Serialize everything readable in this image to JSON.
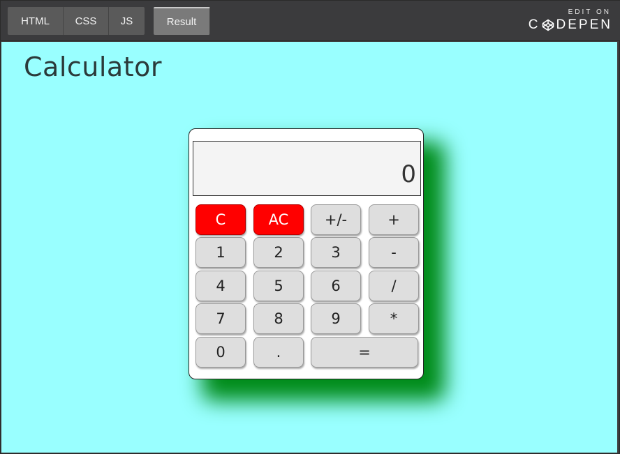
{
  "toolbar": {
    "tabs": [
      "HTML",
      "CSS",
      "JS"
    ],
    "result_tab": "Result",
    "edit_on": "EDIT ON",
    "brand_c": "C",
    "brand_rest": "DEPEN"
  },
  "page": {
    "title": "Calculator"
  },
  "calculator": {
    "display": "0",
    "keys": {
      "clear": "C",
      "all_clear": "AC",
      "negate": "+/-",
      "plus": "+",
      "one": "1",
      "two": "2",
      "three": "3",
      "minus": "-",
      "four": "4",
      "five": "5",
      "six": "6",
      "divide": "/",
      "seven": "7",
      "eight": "8",
      "nine": "9",
      "multiply": "*",
      "zero": "0",
      "decimal": ".",
      "equals": "="
    }
  },
  "colors": {
    "background": "#99ffff",
    "shadow": "#008c1a",
    "clear_key": "#ff0000",
    "key": "#dedede"
  }
}
